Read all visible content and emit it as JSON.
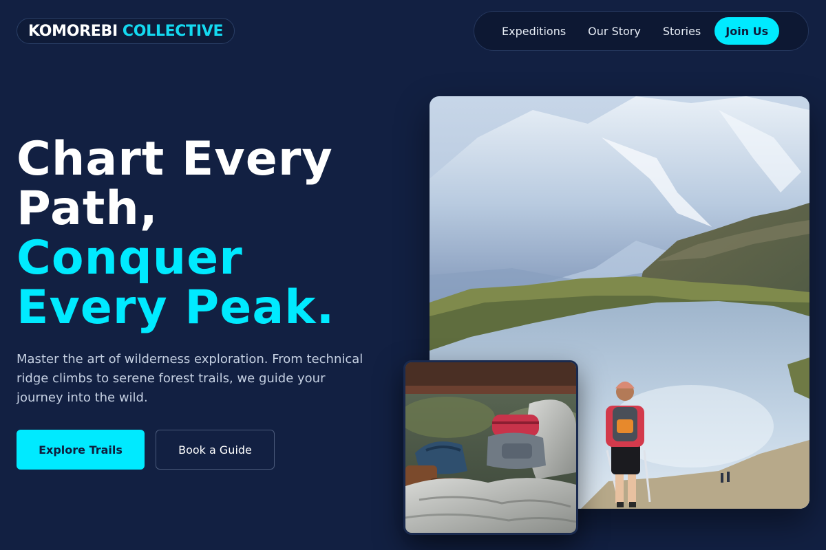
{
  "brand": {
    "name_part1": "KOMOREBI",
    "name_part2": "COLLECTIVE"
  },
  "nav": {
    "links": [
      "Expeditions",
      "Our Story",
      "Stories"
    ],
    "cta": "Join Us"
  },
  "hero": {
    "headline_line1": "Chart Every",
    "headline_line2": "Path,",
    "headline_line3": "Conquer",
    "headline_line4": "Every Peak.",
    "lead": "Master the art of wilderness exploration. From technical ridge climbs to serene forest trails, we guide your journey into the wild.",
    "primary_button": "Explore Trails",
    "secondary_button": "Book a Guide"
  },
  "images": {
    "main": "alpine-lake-hiker-photo",
    "secondary": "backpack-on-rocks-photo"
  },
  "colors": {
    "background": "#122042",
    "accent": "#00eaff",
    "text": "#ffffff",
    "muted_text": "#c5d0e2"
  }
}
